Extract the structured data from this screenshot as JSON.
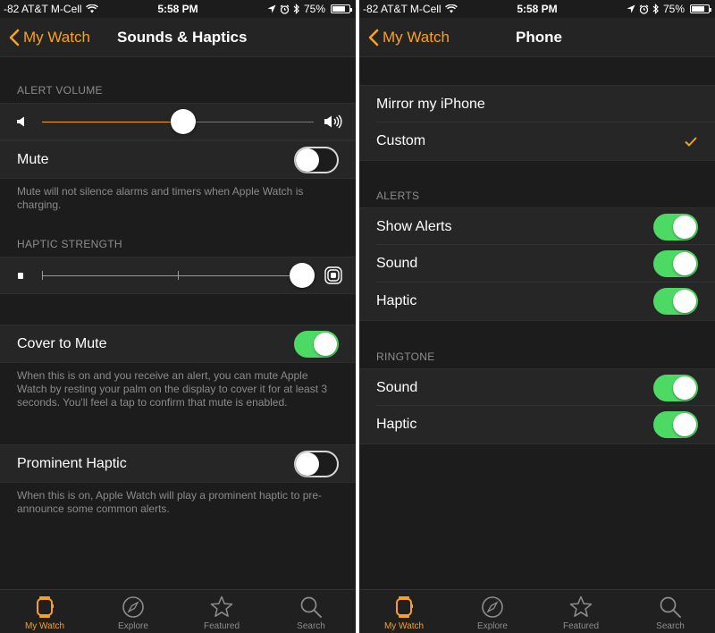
{
  "colors": {
    "accent": "#f7a11f",
    "toggle_on": "#4cd964",
    "background": "#1c1c1c"
  },
  "status": {
    "carrier": "-82 AT&T M-Cell",
    "time": "5:58 PM",
    "battery": "75%",
    "battery_level": 0.75,
    "icons": [
      "wifi-icon",
      "location-icon",
      "alarm-icon",
      "bluetooth-icon",
      "battery-icon"
    ]
  },
  "left": {
    "back_label": "My Watch",
    "title": "Sounds & Haptics",
    "alert_volume": {
      "header": "ALERT VOLUME",
      "level": 0.52
    },
    "mute": {
      "label": "Mute",
      "on": false,
      "note": "Mute will not silence alarms and timers when Apple Watch is charging."
    },
    "haptic_strength": {
      "header": "HAPTIC STRENGTH",
      "level": 1.0
    },
    "cover_to_mute": {
      "label": "Cover to Mute",
      "on": true,
      "note": "When this is on and you receive an alert, you can mute Apple Watch by resting your palm on the display to cover it for at least 3 seconds. You'll feel a tap to confirm that mute is enabled."
    },
    "prominent_haptic": {
      "label": "Prominent Haptic",
      "on": false,
      "note": "When this is on, Apple Watch will play a prominent haptic to pre-announce some common alerts."
    }
  },
  "right": {
    "back_label": "My Watch",
    "title": "Phone",
    "mirror": "Mirror my iPhone",
    "custom": "Custom",
    "alerts_header": "ALERTS",
    "show_alerts": "Show Alerts",
    "alerts_sound": "Sound",
    "alerts_haptic": "Haptic",
    "ringtone_header": "RINGTONE",
    "ringtone_sound": "Sound",
    "ringtone_haptic": "Haptic"
  },
  "tabs": [
    {
      "label": "My Watch",
      "icon": "watch-icon",
      "active": true
    },
    {
      "label": "Explore",
      "icon": "compass-icon",
      "active": false
    },
    {
      "label": "Featured",
      "icon": "star-icon",
      "active": false
    },
    {
      "label": "Search",
      "icon": "search-icon",
      "active": false
    }
  ]
}
